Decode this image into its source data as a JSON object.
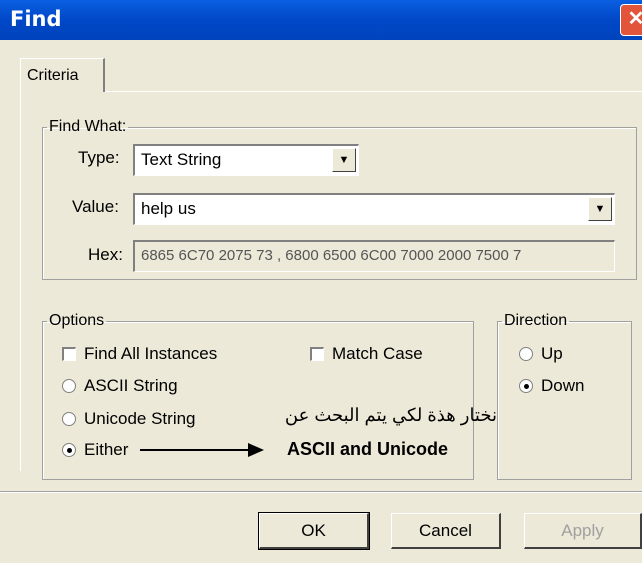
{
  "window": {
    "title": "Find",
    "close_label": "✕"
  },
  "tabs": [
    {
      "label": "Criteria"
    }
  ],
  "find_what": {
    "legend": "Find What:",
    "type_label": "Type:",
    "type_value": "Text String",
    "value_label": "Value:",
    "value_text": "help us",
    "hex_label": "Hex:",
    "hex_value": "6865 6C70 2075 73   , 6800 6500 6C00 7000 2000 7500 7"
  },
  "options": {
    "legend": "Options",
    "find_all": {
      "label": "Find All Instances",
      "checked": false
    },
    "match_case": {
      "label": "Match Case",
      "checked": false
    },
    "ascii": {
      "label": "ASCII String",
      "selected": false
    },
    "unicode": {
      "label": "Unicode String",
      "selected": false
    },
    "either": {
      "label": "Either",
      "selected": true
    }
  },
  "direction": {
    "legend": "Direction",
    "up": {
      "label": "Up",
      "selected": false
    },
    "down": {
      "label": "Down",
      "selected": true
    }
  },
  "annotation": {
    "arabic": "نختار هذة لكي يتم البحث عن",
    "english": "ASCII and Unicode"
  },
  "buttons": {
    "ok": "OK",
    "cancel": "Cancel",
    "apply": "Apply"
  }
}
